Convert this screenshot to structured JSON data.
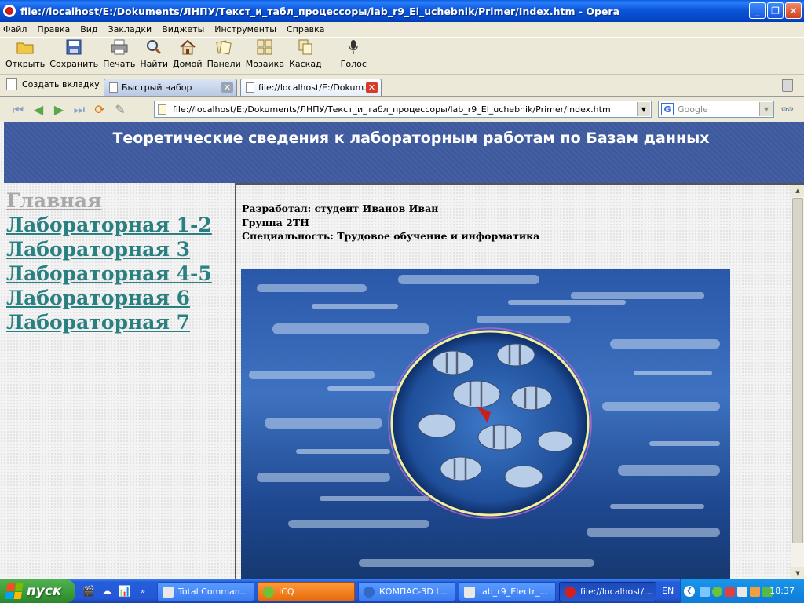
{
  "window": {
    "title": "file://localhost/E:/Dokuments/ЛНПУ/Текст_и_табл_процессоры/lab_r9_El_uchebnik/Primer/Index.htm - Opera"
  },
  "menu": [
    "Файл",
    "Правка",
    "Вид",
    "Закладки",
    "Виджеты",
    "Инструменты",
    "Справка"
  ],
  "toolbar": {
    "open": "Открыть",
    "save": "Сохранить",
    "print": "Печать",
    "find": "Найти",
    "home": "Домой",
    "panels": "Панели",
    "tile": "Мозаика",
    "cascade": "Каскад",
    "voice": "Голос"
  },
  "tabs": {
    "new_tab": "Создать вкладку",
    "items": [
      {
        "label": "Быстрый набор"
      },
      {
        "label": "file://localhost/E:/Dokum..."
      }
    ]
  },
  "address": {
    "url": "file://localhost/E:/Dokuments/ЛНПУ/Текст_и_табл_процессоры/lab_r9_El_uchebnik/Primer/Index.htm",
    "search_placeholder": "Google"
  },
  "page": {
    "banner_title": "Теоретические сведения к лабораторным работам по Базам данных",
    "nav": [
      "Главная",
      "Лабораторная 1-2",
      "Лабораторная 3",
      "Лабораторная 4-5",
      "Лабораторная 6",
      "Лабораторная 7"
    ],
    "info": [
      "Разработал: студент Иванов Иван",
      "Группа 2ТН",
      "Специальность: Трудовое обучение и информатика"
    ]
  },
  "taskbar": {
    "start": "пуск",
    "items": [
      "Total Comman...",
      "ICQ",
      "КОМПАС-3D L...",
      "lab_r9_Electr_...",
      "file://localhost/..."
    ],
    "lang": "EN",
    "clock": "18:37"
  },
  "colors": {
    "banner": "#3e5a9e",
    "nav_link": "#2a7f80",
    "nav_visited": "#a8a8a8"
  }
}
